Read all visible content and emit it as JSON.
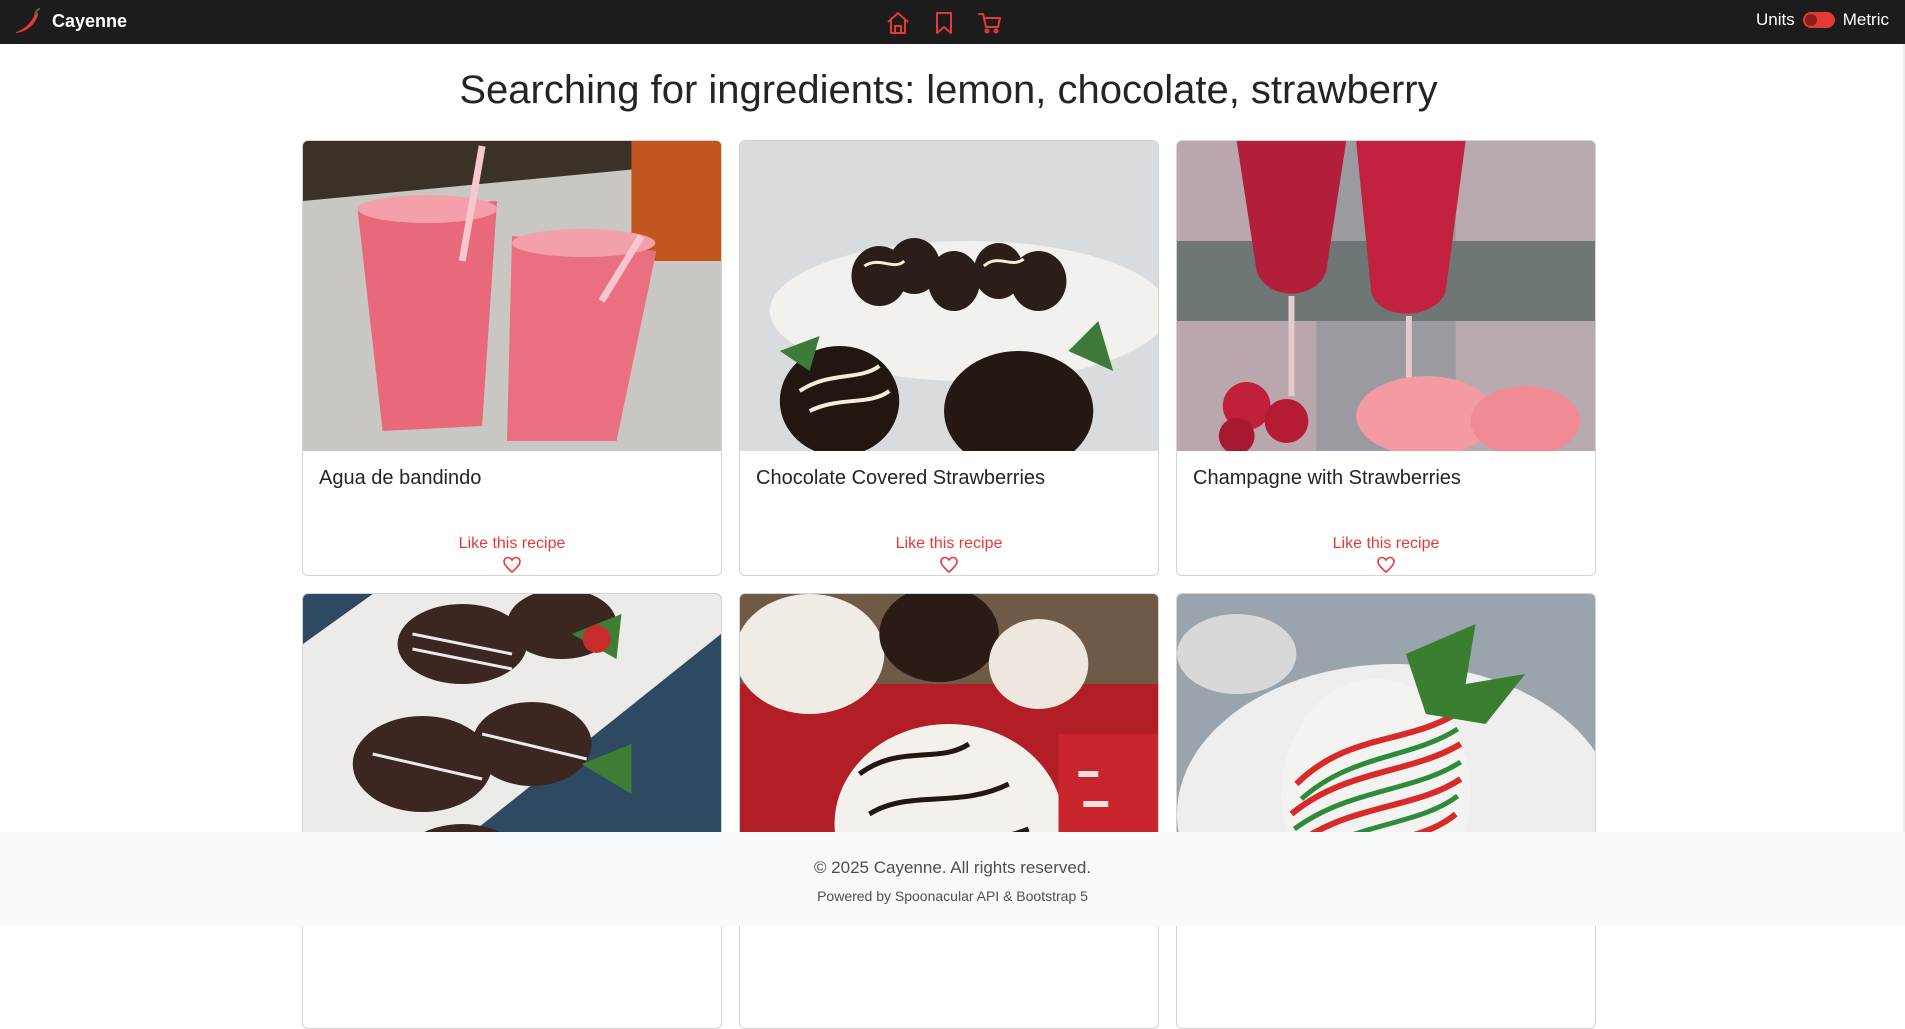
{
  "app": {
    "name": "Cayenne"
  },
  "nav": {
    "icons": [
      "home-icon",
      "bookmark-icon",
      "cart-icon"
    ],
    "units_label": "Units",
    "units_value": "Metric",
    "accent": "#e53935"
  },
  "search": {
    "heading": "Searching for ingredients: lemon, chocolate, strawberry"
  },
  "recipes": [
    {
      "title": "Agua de bandindo",
      "like_label": "Like this recipe"
    },
    {
      "title": "Chocolate Covered Strawberries",
      "like_label": "Like this recipe"
    },
    {
      "title": "Champagne with Strawberries",
      "like_label": "Like this recipe"
    },
    {
      "title": "",
      "like_label": ""
    },
    {
      "title": "",
      "like_label": ""
    },
    {
      "title": "",
      "like_label": ""
    }
  ],
  "footer": {
    "copyright": "© 2025 Cayenne. All rights reserved.",
    "powered": "Powered by Spoonacular API & Bootstrap 5"
  }
}
